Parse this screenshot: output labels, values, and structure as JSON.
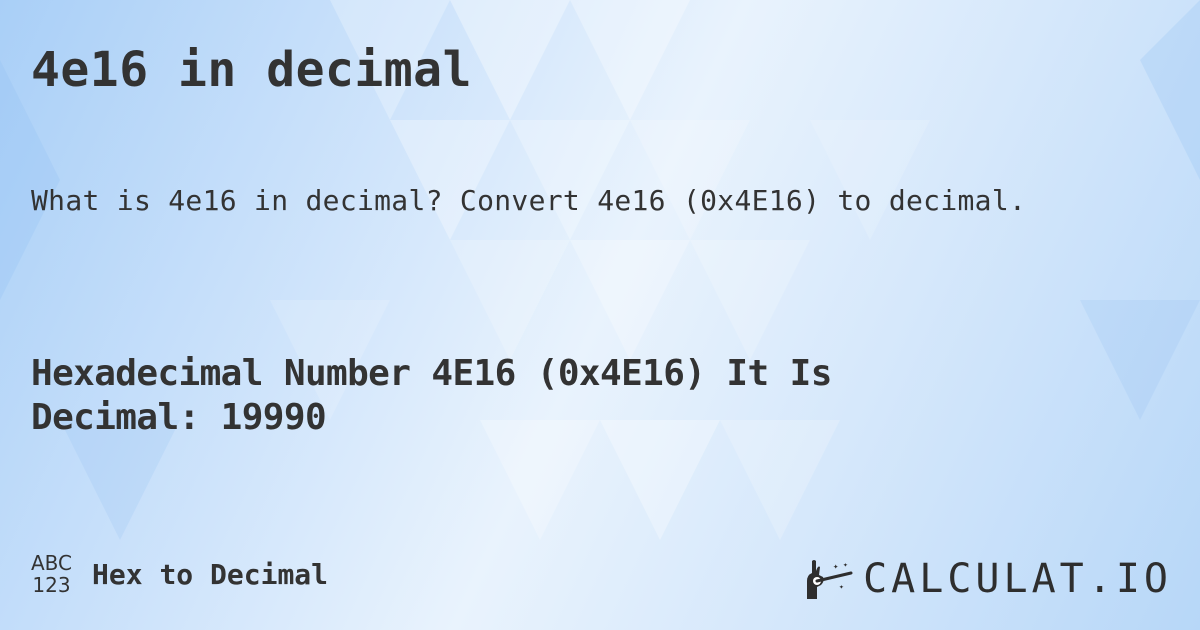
{
  "title": "4e16 in decimal",
  "subtitle": "What is 4e16 in decimal? Convert 4e16 (0x4E16) to decimal.",
  "answer": {
    "line1": "Hexadecimal Number 4E16 (0x4E16) It Is",
    "line2": "Decimal: 19990"
  },
  "footer": {
    "icon_top": "ABC",
    "icon_bottom": "123",
    "category": "Hex to Decimal"
  },
  "brand": {
    "icon": "magic-wand-hand-icon",
    "name": "CALCULAT.IO"
  },
  "colors": {
    "text": "#333333",
    "background_light": "#e9f3fd",
    "background_dark": "#a9cff7"
  }
}
